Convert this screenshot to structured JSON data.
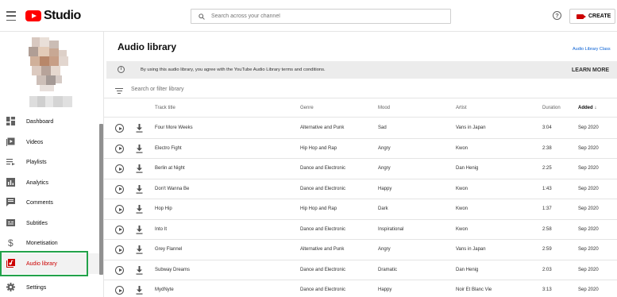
{
  "app": {
    "logo_text": "Studio",
    "brand_color": "#ff0000",
    "active_color": "#cc0000"
  },
  "header": {
    "search_placeholder": "Search across your channel",
    "help_symbol": "?",
    "create_label": "CREATE"
  },
  "sidebar": {
    "items": [
      {
        "label": "Dashboard",
        "icon": "dashboard-icon"
      },
      {
        "label": "Videos",
        "icon": "videos-icon"
      },
      {
        "label": "Playlists",
        "icon": "playlists-icon"
      },
      {
        "label": "Analytics",
        "icon": "analytics-icon"
      },
      {
        "label": "Comments",
        "icon": "comments-icon"
      },
      {
        "label": "Subtitles",
        "icon": "subtitles-icon"
      },
      {
        "label": "Monetisation",
        "icon": "dollar-icon"
      },
      {
        "label": "Audio library",
        "icon": "audio-library-icon",
        "active": true
      },
      {
        "label": "Settings",
        "icon": "gear-icon"
      }
    ]
  },
  "main": {
    "title": "Audio library",
    "class_link": "Audio Library Class",
    "notice": {
      "info_symbol": "i",
      "text": "By using this audio library, you agree with the YouTube Audio Library terms and conditions.",
      "action": "LEARN MORE"
    },
    "filter_placeholder": "Search or filter library",
    "columns": [
      "Track title",
      "Genre",
      "Mood",
      "Artist",
      "Duration",
      "Added"
    ],
    "sorted_column": "Added",
    "sort_arrow": "↓",
    "rows": [
      {
        "title": "Four More Weeks",
        "genre": "Alternative and Punk",
        "mood": "Sad",
        "artist": "Vans in Japan",
        "duration": "3:04",
        "added": "Sep 2020"
      },
      {
        "title": "Electro Fight",
        "genre": "Hip Hop and Rap",
        "mood": "Angry",
        "artist": "Kwon",
        "duration": "2:38",
        "added": "Sep 2020"
      },
      {
        "title": "Berlin at Night",
        "genre": "Dance and Electronic",
        "mood": "Angry",
        "artist": "Dan Henig",
        "duration": "2:25",
        "added": "Sep 2020"
      },
      {
        "title": "Don't Wanna Be",
        "genre": "Dance and Electronic",
        "mood": "Happy",
        "artist": "Kwon",
        "duration": "1:43",
        "added": "Sep 2020"
      },
      {
        "title": "Hop Hip",
        "genre": "Hip Hop and Rap",
        "mood": "Dark",
        "artist": "Kwon",
        "duration": "1:37",
        "added": "Sep 2020"
      },
      {
        "title": "Into It",
        "genre": "Dance and Electronic",
        "mood": "Inspirational",
        "artist": "Kwon",
        "duration": "2:58",
        "added": "Sep 2020"
      },
      {
        "title": "Grey Flannel",
        "genre": "Alternative and Punk",
        "mood": "Angry",
        "artist": "Vans in Japan",
        "duration": "2:59",
        "added": "Sep 2020"
      },
      {
        "title": "Subway Dreams",
        "genre": "Dance and Electronic",
        "mood": "Dramatic",
        "artist": "Dan Henig",
        "duration": "2:03",
        "added": "Sep 2020"
      },
      {
        "title": "MydNyte",
        "genre": "Dance and Electronic",
        "mood": "Happy",
        "artist": "Noir Et Blanc Vie",
        "duration": "3:13",
        "added": "Sep 2020"
      }
    ]
  }
}
